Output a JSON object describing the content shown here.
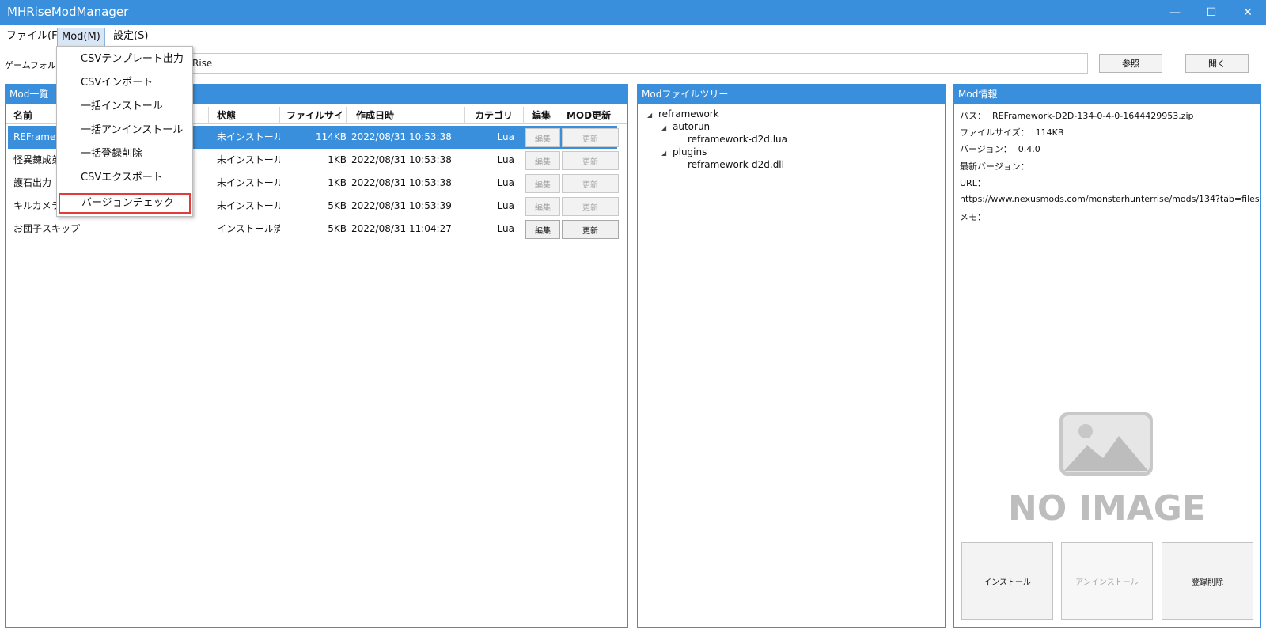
{
  "window": {
    "title": "MHRiseModManager",
    "minimize": "—",
    "maximize": "☐",
    "close": "✕"
  },
  "menu": {
    "file": "ファイル(F)",
    "mod": "Mod(M)",
    "settings": "設定(S)"
  },
  "mod_menu": {
    "items": [
      "CSVテンプレート出力",
      "CSVインポート",
      "一括インストール",
      "一括アンインストール",
      "一括登録削除",
      "CSVエクスポート",
      "バージョンチェック"
    ]
  },
  "folder": {
    "label": "ゲームフォルダ",
    "value_fragment": "Rise",
    "browse_label": "参照",
    "open_label": "開く"
  },
  "mod_list": {
    "header": "Mod一覧",
    "columns": {
      "name": "名前",
      "status": "状態",
      "size": "ファイルサイズ",
      "date": "作成日時",
      "category": "カテゴリ",
      "edit": "編集",
      "update": "MOD更新"
    },
    "edit_label": "編集",
    "update_label": "更新",
    "rows": [
      {
        "name": "REFramework",
        "status": "未インストール",
        "size": "114KB",
        "date": "2022/08/31 10:53:38",
        "category": "Lua"
      },
      {
        "name": "怪異錬成弟",
        "status": "未インストール",
        "size": "1KB",
        "date": "2022/08/31 10:53:38",
        "category": "Lua"
      },
      {
        "name": "護石出力",
        "status": "未インストール",
        "size": "1KB",
        "date": "2022/08/31 10:53:38",
        "category": "Lua"
      },
      {
        "name": "キルカメラ削",
        "status": "未インストール",
        "size": "5KB",
        "date": "2022/08/31 10:53:39",
        "category": "Lua"
      },
      {
        "name": "お団子スキップ",
        "status": "インストール済",
        "size": "5KB",
        "date": "2022/08/31 11:04:27",
        "category": "Lua"
      }
    ]
  },
  "file_tree": {
    "header": "Modファイルツリー",
    "root": "reframework",
    "autorun": "autorun",
    "autorun_file": "reframework-d2d.lua",
    "plugins": "plugins",
    "plugins_file": "reframework-d2d.dll"
  },
  "mod_info": {
    "header": "Mod情報",
    "path_label": "パス：",
    "path_value": "REFramework-D2D-134-0-4-0-1644429953.zip",
    "size_label": "ファイルサイズ：",
    "size_value": "114KB",
    "version_label": "バージョン：",
    "version_value": "0.4.0",
    "latest_label": "最新バージョン：",
    "url_label": "URL：",
    "url_value": "https://www.nexusmods.com/monsterhunterrise/mods/134?tab=files",
    "memo_label": "メモ：",
    "noimage_text": "NO IMAGE",
    "install_label": "インストール",
    "uninstall_label": "アンインストール",
    "delete_label": "登録削除"
  },
  "colors": {
    "accent": "#3a8fdc",
    "highlight_border": "#e23b3b"
  }
}
